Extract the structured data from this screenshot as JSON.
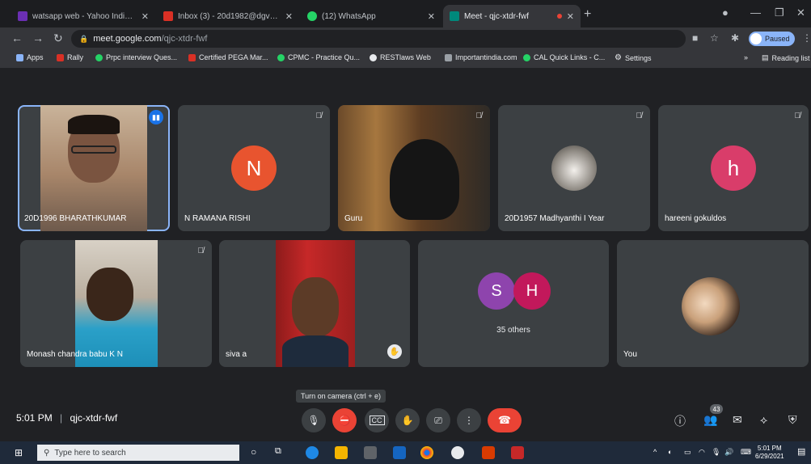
{
  "tabs": [
    {
      "title": "watsapp web - Yahoo India Sear",
      "fav": "#6b2fb3"
    },
    {
      "title": "Inbox (3) - 20d1982@dgvaishn",
      "fav": "#d93025"
    },
    {
      "title": "(12) WhatsApp",
      "fav": "#25d366"
    },
    {
      "title": "Meet - qjc-xtdr-fwf",
      "fav": "#00897b"
    }
  ],
  "address": {
    "host": "meet.google.com",
    "path": "/qjc-xtdr-fwf"
  },
  "profile_label": "Paused",
  "bookmarks": [
    {
      "label": "Apps",
      "color": "#8ab4f8"
    },
    {
      "label": "Rally",
      "color": "#d93025"
    },
    {
      "label": "Prpc interview Ques...",
      "color": "#25d366"
    },
    {
      "label": "Certified PEGA Mar...",
      "color": "#d93025"
    },
    {
      "label": "CPMC - Practice Qu...",
      "color": "#25d366"
    },
    {
      "label": "RESTlaws Web",
      "color": "#e8eaed"
    },
    {
      "label": "Importantindia.com",
      "color": "#9aa0a6"
    },
    {
      "label": "CAL Quick Links - C...",
      "color": "#25d366"
    },
    {
      "label": "Settings",
      "color": "#e8eaed"
    }
  ],
  "reading_list": "Reading list",
  "participants": {
    "p1": {
      "name": "20D1996 BHARATHKUMAR"
    },
    "p2": {
      "name": "N RAMANA RISHI",
      "initial": "N",
      "color": "#e8542f"
    },
    "p3": {
      "name": "Guru"
    },
    "p4": {
      "name": "20D1957 Madhyanthi I Year"
    },
    "p5": {
      "name": "hareeni gokuldos",
      "initial": "h",
      "color": "#d93d6a"
    },
    "p6": {
      "name": "Monash chandra babu K N"
    },
    "p7": {
      "name": "siva a"
    },
    "others": {
      "label": "35 others",
      "a": "S",
      "b": "H",
      "a_color": "#8e44ad",
      "b_color": "#c2185b"
    },
    "self": {
      "name": "You"
    }
  },
  "tooltip": "Turn on camera (ctrl + e)",
  "meeting": {
    "time": "5:01 PM",
    "separator": "|",
    "code": "qjc-xtdr-fwf"
  },
  "people_count": "43",
  "taskbar": {
    "search_placeholder": "Type here to search",
    "time": "5:01 PM",
    "date": "6/29/2021"
  }
}
